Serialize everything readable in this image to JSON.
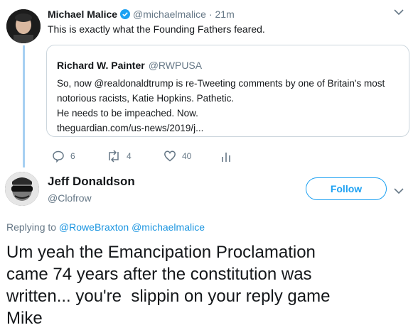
{
  "tweet1": {
    "name": "Michael Malice",
    "handle": "@michaelmalice",
    "time": "· 21m",
    "text": "This is exactly what the Founding Fathers feared."
  },
  "quote": {
    "name": "Richard W. Painter",
    "handle": "@RWPUSA",
    "line1": "So, now @realdonaldtrump is re-Tweeting comments by one of Britain's most",
    "line2": "notorious racists, Katie Hopkins. Pathetic.",
    "line3": "He needs to be impeached. Now.",
    "link": "theguardian.com/us-news/2019/j..."
  },
  "actions": {
    "replies": "6",
    "retweets": "4",
    "likes": "40"
  },
  "tweet2": {
    "name": "Jeff Donaldson",
    "handle": "@Clofrow",
    "follow_label": "Follow",
    "replying_to_label": "Replying to",
    "replying_to_1": "@RoweBraxton",
    "replying_to_2": "@michaelmalice",
    "line1": "Um yeah the Emancipation Proclamation",
    "line2": "came 74 years after the constitution was",
    "line3": "written... you're  slippin on your reply game",
    "line4": "Mike"
  },
  "colors": {
    "accent": "#1da1f2",
    "verified": "#1da1f2",
    "thread_line": "#a6d0f2",
    "muted": "#657786"
  }
}
